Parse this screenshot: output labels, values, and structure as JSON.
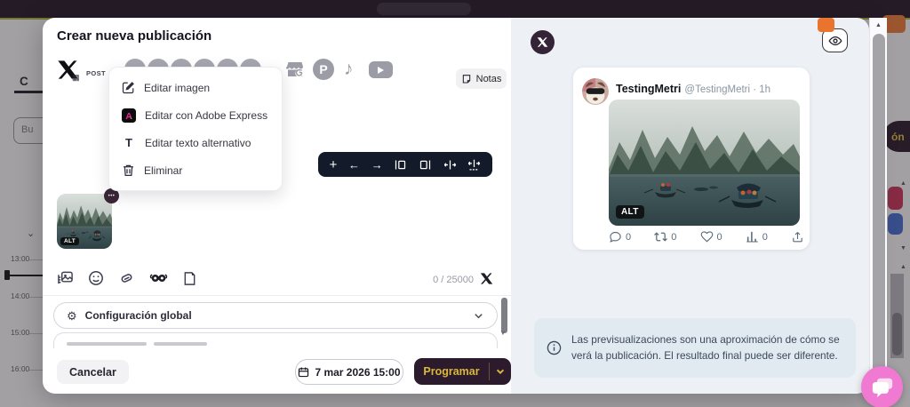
{
  "icons": {
    "plus": "+",
    "arrow_left": "←",
    "arrow_right": "→",
    "more": "•••",
    "grid": "▦",
    "scroll_up": "▲",
    "scroll_down": "▼",
    "caret_down": "▾",
    "chevron_down": "⌄"
  },
  "background": {
    "tab_partial": "C",
    "search_partial": "Bu",
    "times": [
      "13:00",
      "14:00",
      "15:00",
      "16:00"
    ],
    "create_button_partial": "ón"
  },
  "modal": {
    "title": "Crear nueva publicación",
    "network_bar": {
      "post_type_label": "POST",
      "notes_label": "Notas"
    },
    "image_menu": {
      "items": [
        {
          "label": "Editar imagen"
        },
        {
          "label": "Editar con Adobe Express"
        },
        {
          "label": "Editar texto alternativo"
        },
        {
          "label": "Eliminar"
        }
      ]
    },
    "editor": {
      "char_counter": "0 / 25000",
      "alt_badge": "ALT"
    },
    "global_config_label": "Configuración global",
    "footer": {
      "cancel_label": "Cancelar",
      "schedule_date": "7 mar 2026 15:00",
      "schedule_label": "Programar"
    }
  },
  "preview": {
    "post": {
      "author": "TestingMetri",
      "meta": "@TestingMetri · 1h",
      "alt_badge": "ALT",
      "stats": [
        {
          "name": "replies",
          "count": "0"
        },
        {
          "name": "reposts",
          "count": "0"
        },
        {
          "name": "likes",
          "count": "0"
        },
        {
          "name": "views",
          "count": "0"
        }
      ]
    },
    "disclaimer": "Las previsualizaciones son una aproximación de cómo se verá la publicación. El resultado final puede ser diferente."
  },
  "colors": {
    "accent_yellow": "#d9b83a",
    "primary_dark": "#2c1b2c",
    "chat_pink": "#f07ad2",
    "preview_bg": "#edf1f6",
    "info_bg": "#e1e9f1",
    "topbar": "#1c1120",
    "accent_line": "#a8b038",
    "badge_red": "#c52c50",
    "badge_blue": "#3e68cb",
    "badge_orange": "#e8742e"
  }
}
